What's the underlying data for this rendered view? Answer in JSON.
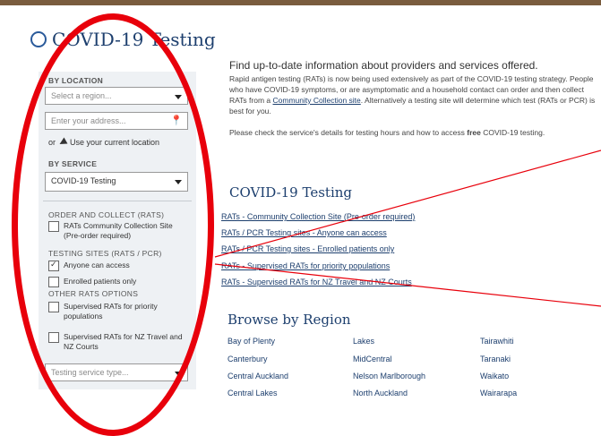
{
  "page": {
    "title": "COVID-19 Testing"
  },
  "sidebar": {
    "by_location": "BY LOCATION",
    "region_placeholder": "Select a region...",
    "address_placeholder": "Enter your address...",
    "or": "or",
    "use_location": "Use your current location",
    "by_service": "BY SERVICE",
    "service_value": "COVID-19 Testing",
    "order_collect": "ORDER AND COLLECT (RATS)",
    "rats_community": "RATs Community Collection Site (Pre-order required)",
    "testing_sites": "TESTING SITES (RATS / PCR)",
    "anyone": "Anyone can access",
    "enrolled": "Enrolled patients only",
    "other_rats": "OTHER RATS OPTIONS",
    "supervised_priority": "Supervised RATs for priority populations",
    "supervised_travel": "Supervised RATs for NZ Travel and NZ Courts",
    "type_placeholder": "Testing service type..."
  },
  "main": {
    "intro_title": "Find up-to-date information about providers and services offered.",
    "intro_p1_a": "Rapid antigen testing (RATs) is now being used extensively as part of the COVID-19 testing strategy. People who have COVID-19 symptoms, or are asymptomatic and a household contact can order and then collect RATs from a ",
    "intro_p1_link": "Community Collection site",
    "intro_p1_b": ". Alternatively a testing site will determine which test (RATs or PCR) is best for you.",
    "intro_p2_a": "Please check the service's details for testing hours and how to access ",
    "intro_p2_bold": "free",
    "intro_p2_b": " COVID-19 testing.",
    "section_title": "COVID-19 Testing",
    "links": [
      "RATs - Community Collection Site (Pre-order required)",
      "RATs / PCR Testing sites - Anyone can access",
      "RATs / PCR Testing sites - Enrolled patients only",
      "RATs - Supervised RATs for priority populations",
      "RATs - Supervised RATs for NZ Travel and NZ Courts"
    ],
    "browse_title": "Browse by Region",
    "regions": [
      [
        "Bay of Plenty",
        "Lakes",
        "Tairawhiti"
      ],
      [
        "Canterbury",
        "MidCentral",
        "Taranaki"
      ],
      [
        "Central Auckland",
        "Nelson Marlborough",
        "Waikato"
      ],
      [
        "Central Lakes",
        "North Auckland",
        "Wairarapa"
      ]
    ]
  },
  "annotation_color": "#e8000b"
}
